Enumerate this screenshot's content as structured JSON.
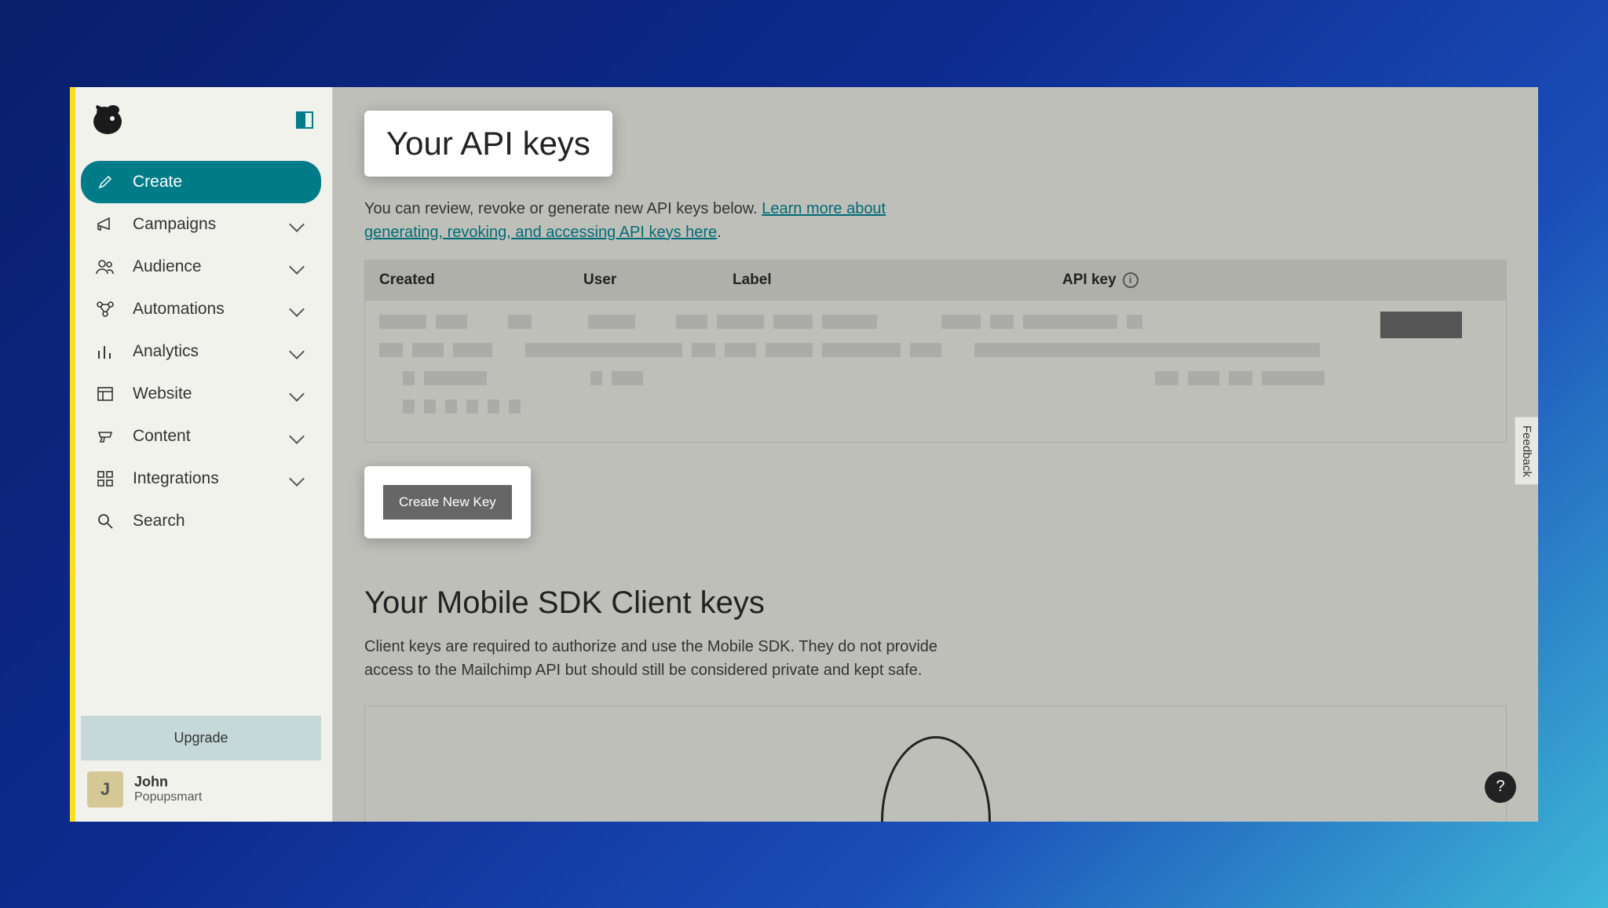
{
  "sidebar": {
    "create_label": "Create",
    "items": [
      {
        "label": "Campaigns"
      },
      {
        "label": "Audience"
      },
      {
        "label": "Automations"
      },
      {
        "label": "Analytics"
      },
      {
        "label": "Website"
      },
      {
        "label": "Content"
      },
      {
        "label": "Integrations"
      }
    ],
    "search_label": "Search",
    "upgrade_label": "Upgrade",
    "user": {
      "initial": "J",
      "name": "John",
      "org": "Popupsmart"
    }
  },
  "main": {
    "page_title": "Your API keys",
    "intro_prefix": "You can review, revoke or generate new API keys below. ",
    "intro_link": "Learn more about generating, revoking, and accessing API keys here",
    "intro_suffix": ".",
    "table": {
      "col_created": "Created",
      "col_user": "User",
      "col_label": "Label",
      "col_apikey": "API key"
    },
    "create_key_btn": "Create New Key",
    "sdk_title": "Your Mobile SDK Client keys",
    "sdk_text": "Client keys are required to authorize and use the Mobile SDK. They do not provide access to the Mailchimp API but should still be considered private and kept safe.",
    "feedback_label": "Feedback",
    "help_label": "?"
  }
}
